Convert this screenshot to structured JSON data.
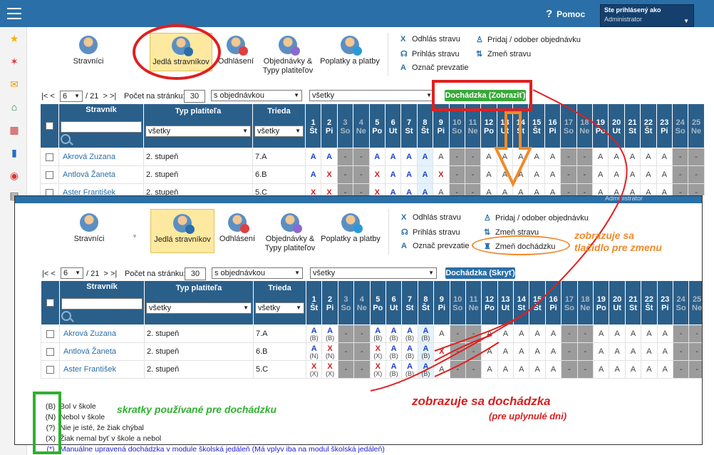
{
  "app": {
    "help_label": "Pomoc",
    "user_label": "Ste prihlásený ako",
    "user_name": "Administrator"
  },
  "sidebar_icons": [
    "star-icon",
    "magic-wand-icon",
    "mail-icon",
    "home-icon",
    "calendar-icon",
    "book-icon",
    "user-circle-icon"
  ],
  "modules": [
    {
      "label": "Stravníci"
    },
    {
      "label": "Jedlá stravníkov"
    },
    {
      "label": "Odhlásení"
    },
    {
      "label": "Objednávky & Typy platiteľov"
    },
    {
      "label": "Poplatky a platby"
    }
  ],
  "actions": {
    "odhlas": "Odhlás stravu",
    "prihlas": "Prihlás stravu",
    "oznac": "Označ prevzatie",
    "pridaj": "Pridaj / odober objednávku",
    "zmen": "Zmeň stravu",
    "zmen_doch": "Zmeň dochádzku"
  },
  "paging": {
    "first": "|<",
    "prev": "<",
    "page": "6",
    "of": "/ 21",
    "next": ">",
    "last": ">|",
    "per_page_label": "Počet na stránku:",
    "per_page": "30",
    "filter1": "s objednávkou",
    "filter2": "všetky"
  },
  "buttons": {
    "show": "Dochádzka (Zobraziť)",
    "hide": "Dochádzka (Skryť)"
  },
  "columns": {
    "stravnik": "Stravník",
    "typ": "Typ platiteľa",
    "trieda": "Trieda",
    "filter_typ": "všetky",
    "filter_trieda": "všetky"
  },
  "days": [
    {
      "n": "1",
      "d": "Št"
    },
    {
      "n": "2",
      "d": "Pi"
    },
    {
      "n": "3",
      "d": "So"
    },
    {
      "n": "4",
      "d": "Ne"
    },
    {
      "n": "5",
      "d": "Po"
    },
    {
      "n": "6",
      "d": "Ut"
    },
    {
      "n": "7",
      "d": "St"
    },
    {
      "n": "8",
      "d": "Št"
    },
    {
      "n": "9",
      "d": "Pi"
    },
    {
      "n": "10",
      "d": "So"
    },
    {
      "n": "11",
      "d": "Ne"
    },
    {
      "n": "12",
      "d": "Po"
    },
    {
      "n": "13",
      "d": "Ut"
    },
    {
      "n": "14",
      "d": "St"
    },
    {
      "n": "15",
      "d": "Št"
    },
    {
      "n": "16",
      "d": "Pi"
    },
    {
      "n": "17",
      "d": "So"
    },
    {
      "n": "18",
      "d": "Ne"
    },
    {
      "n": "19",
      "d": "Po"
    },
    {
      "n": "20",
      "d": "Ut"
    },
    {
      "n": "21",
      "d": "St"
    },
    {
      "n": "22",
      "d": "Št"
    },
    {
      "n": "23",
      "d": "Pi"
    },
    {
      "n": "24",
      "d": "So"
    },
    {
      "n": "25",
      "d": "Ne"
    }
  ],
  "weekend_days": [
    3,
    4,
    10,
    11,
    17,
    18,
    24,
    25
  ],
  "rows_top": [
    {
      "name": "Akrová Zuzana",
      "typ": "2. stupeň",
      "trieda": "7.A",
      "cells": [
        "A",
        "A",
        "-",
        "-",
        "A",
        "A",
        "A",
        "A",
        "A",
        "-",
        "-",
        "A",
        "A",
        "A",
        "A",
        "A",
        "-",
        "-",
        "A",
        "A",
        "A",
        "A",
        "A",
        "-",
        "-"
      ]
    },
    {
      "name": "Antlová Žaneta",
      "typ": "2. stupeň",
      "trieda": "6.B",
      "cells": [
        "A",
        "X",
        "-",
        "-",
        "X",
        "A",
        "A",
        "A",
        "X",
        "-",
        "-",
        "A",
        "A",
        "A",
        "A",
        "A",
        "-",
        "-",
        "A",
        "A",
        "A",
        "A",
        "A",
        "-",
        "-"
      ]
    },
    {
      "name": "Aster František",
      "typ": "2. stupeň",
      "trieda": "5.C",
      "cells": [
        "X",
        "X",
        "-",
        "-",
        "X",
        "A",
        "A",
        "A",
        "A",
        "-",
        "-",
        "A",
        "A",
        "A",
        "A",
        "A",
        "-",
        "-",
        "A",
        "A",
        "A",
        "A",
        "A",
        "-",
        "-"
      ]
    }
  ],
  "rows_bottom": [
    {
      "name": "Akrová Zuzana",
      "typ": "2. stupeň",
      "trieda": "7.A",
      "cells": [
        "A",
        "A",
        "-",
        "-",
        "A",
        "A",
        "A",
        "A",
        "A",
        "-",
        "-",
        "A",
        "A",
        "A",
        "A",
        "A",
        "-",
        "-",
        "A",
        "A",
        "A",
        "A",
        "A",
        "-",
        "-"
      ],
      "subs": [
        "(B)",
        "(B)",
        "",
        "",
        "(B)",
        "(B)",
        "(B)",
        "(B)"
      ]
    },
    {
      "name": "Antlová Žaneta",
      "typ": "2. stupeň",
      "trieda": "6.B",
      "cells": [
        "A",
        "X",
        "-",
        "-",
        "X",
        "A",
        "A",
        "A",
        "X",
        "-",
        "-",
        "A",
        "A",
        "A",
        "A",
        "A",
        "-",
        "-",
        "A",
        "A",
        "A",
        "A",
        "A",
        "-",
        "-"
      ],
      "subs": [
        "(N)",
        "(N)",
        "",
        "",
        "(X)",
        "(B)",
        "(B)",
        "(B)"
      ]
    },
    {
      "name": "Aster František",
      "typ": "2. stupeň",
      "trieda": "5.C",
      "cells": [
        "X",
        "X",
        "-",
        "-",
        "X",
        "A",
        "A",
        "A",
        "A",
        "-",
        "-",
        "A",
        "A",
        "A",
        "A",
        "A",
        "-",
        "-",
        "A",
        "A",
        "A",
        "A",
        "A",
        "-",
        "-"
      ],
      "subs": [
        "(X)",
        "(X)",
        "",
        "",
        "(X)",
        "(B)",
        "(B)",
        "(B)"
      ]
    }
  ],
  "legend": [
    {
      "code": "(B)",
      "text": "Bol v škole"
    },
    {
      "code": "(N)",
      "text": "Nebol v škole"
    },
    {
      "code": "(?)",
      "text": "Nie je isté, že žiak chýbal"
    },
    {
      "code": "(X)",
      "text": "Žiak nemal byť v škole a nebol"
    },
    {
      "code": "(*)",
      "text": "Manuálne upravená dochádzka v module školská jedáleň (Má vplyv iba na modul školská jedáleň)"
    }
  ],
  "annotations": {
    "button_note": "zobrazuje sa\ntlačidlo pre zmenu",
    "codes_note": "skratky používané pre dochádzku",
    "att_note": "zobrazuje sa dochádzka",
    "att_sub": "(pre uplynulé dni)"
  },
  "colors": {
    "header": "#2a6fa7",
    "present": "#1e44c8",
    "absent": "#cc2222",
    "weekend": "#9c9c9c",
    "annot_red": "#e02020",
    "annot_orange": "#f08a2a",
    "annot_green": "#2fb02f"
  }
}
